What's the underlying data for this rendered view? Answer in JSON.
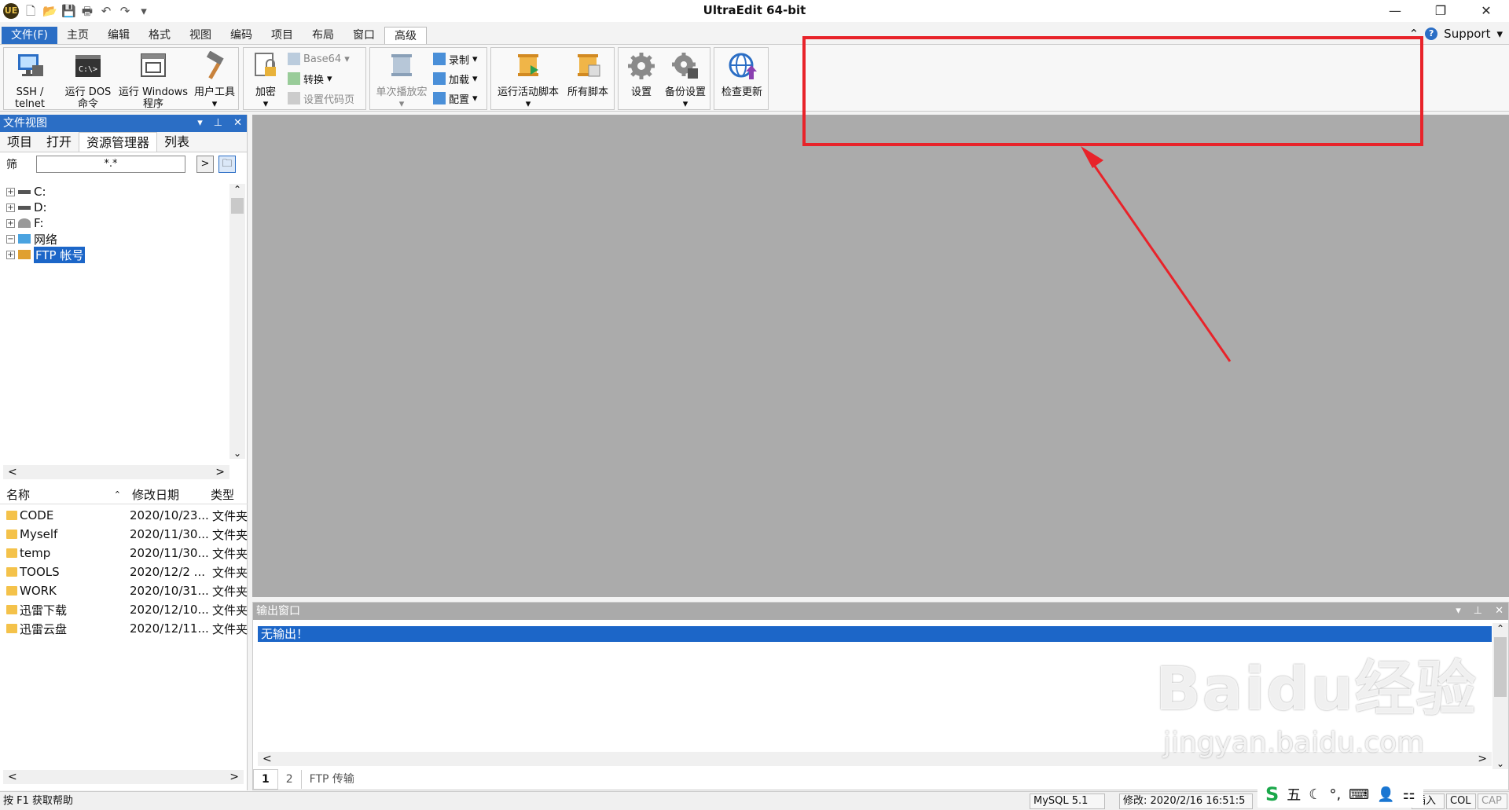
{
  "window": {
    "title": "UltraEdit 64-bit",
    "support_label": "Support",
    "controls": {
      "minimize": "—",
      "restore": "❐",
      "close": "✕"
    }
  },
  "quick_access": {
    "icons": [
      "new-file-icon",
      "open-folder-icon",
      "save-icon",
      "print-icon",
      "undo-icon",
      "redo-icon",
      "customize-icon"
    ]
  },
  "ribbon_tabs": [
    "文件(F)",
    "主页",
    "编辑",
    "格式",
    "视图",
    "编码",
    "项目",
    "布局",
    "窗口",
    "高级"
  ],
  "ribbon_active_tab": "高级",
  "ribbon": {
    "ssh": "SSH /\ntelnet",
    "dos": "运行 DOS\n命令",
    "windows": "运行 Windows\n程序",
    "usertools": "用户工具",
    "encrypt": "加密",
    "base64": "Base64",
    "convert": "转换",
    "setcodepage": "设置代码页",
    "single_play": "单次播放宏",
    "record": "录制",
    "load": "加载",
    "config": "配置",
    "run_active_script": "运行活动脚本",
    "all_scripts": "所有脚本",
    "settings": "设置",
    "backup_settings": "备份设置",
    "check_update": "检查更新"
  },
  "file_view": {
    "title": "文件视图",
    "tabs": [
      "项目",
      "打开",
      "资源管理器",
      "列表"
    ],
    "active_tab": "资源管理器",
    "filter_label": "筛",
    "filter_value": "*.*",
    "tree": [
      {
        "label": "C:",
        "icon": "drive-icon"
      },
      {
        "label": "D:",
        "icon": "drive-icon"
      },
      {
        "label": "F:",
        "icon": "network-drive-icon"
      },
      {
        "label": "网络",
        "icon": "network-icon"
      },
      {
        "label": "FTP 帐号",
        "icon": "ftp-icon",
        "selected": true
      }
    ],
    "columns": [
      "名称",
      "修改日期",
      "类型"
    ],
    "files": [
      {
        "name": "CODE",
        "date": "2020/10/23...",
        "type": "文件夹"
      },
      {
        "name": "Myself",
        "date": "2020/11/30...",
        "type": "文件夹"
      },
      {
        "name": "temp",
        "date": "2020/11/30...",
        "type": "文件夹"
      },
      {
        "name": "TOOLS",
        "date": "2020/12/2 ...",
        "type": "文件夹"
      },
      {
        "name": "WORK",
        "date": "2020/10/31...",
        "type": "文件夹"
      },
      {
        "name": "迅雷下载",
        "date": "2020/12/10...",
        "type": "文件夹"
      },
      {
        "name": "迅雷云盘",
        "date": "2020/12/11...",
        "type": "文件夹"
      }
    ]
  },
  "output": {
    "title": "输出窗口",
    "line": "无输出！",
    "tabs": [
      "1",
      "2",
      "FTP 传输"
    ]
  },
  "status": {
    "help": "按 F1 获取帮助",
    "language": "MySQL 5.1",
    "modified": "修改:  2020/2/16 16:51:5",
    "insert": "插入",
    "col": "COL",
    "cap": "CAP"
  },
  "ime": {
    "mode": "五"
  },
  "watermark": {
    "line1": "Baidu经验",
    "line2": "jingyan.baidu.com"
  },
  "colors": {
    "accent": "#2b6ec5",
    "highlight": "#e8232a",
    "editor_bg": "#ababab"
  }
}
